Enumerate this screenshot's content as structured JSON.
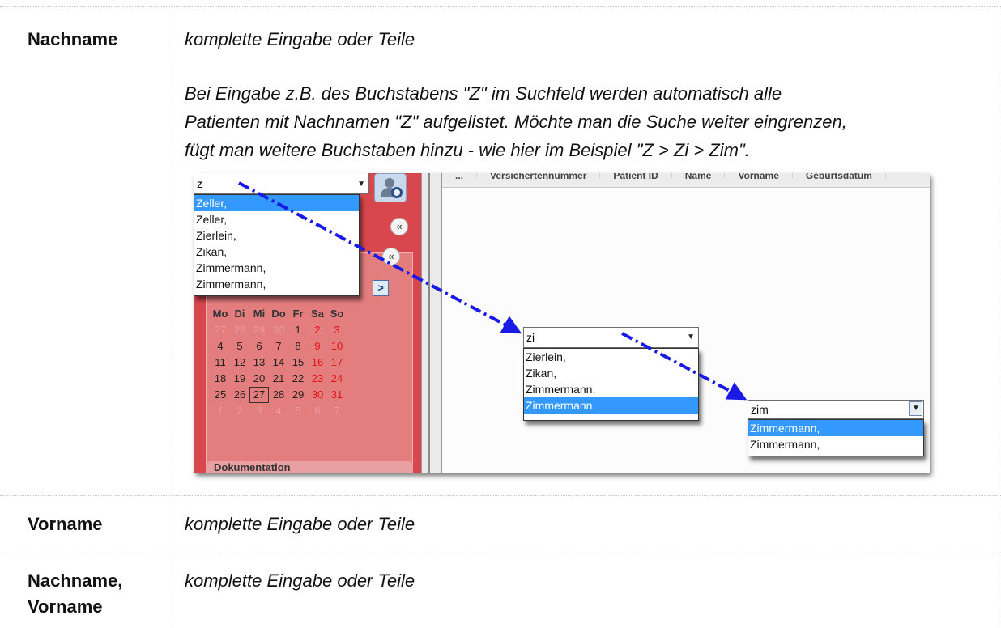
{
  "rows": [
    {
      "label": "Nachname",
      "desc": "komplette Eingabe oder Teile",
      "para_lines": [
        "Bei Eingabe z.B. des Buchstabens \"Z\" im Suchfeld werden automatisch alle",
        "Patienten mit Nachnamen \"Z\" aufgelistet. Möchte man die Suche weiter eingrenzen,",
        "fügt man weitere Buchstaben hinzu - wie hier im Beispiel \"Z > Zi > Zim\"."
      ]
    },
    {
      "label": "Vorname",
      "desc": "komplette Eingabe oder Teile"
    },
    {
      "label_line1": "Nachname,",
      "label_line2": "Vorname",
      "desc": "komplette Eingabe oder Teile"
    }
  ],
  "screenshot": {
    "combo1": {
      "value": "z",
      "items": [
        "Zeller,",
        "Zeller,",
        "Zierlein,",
        "Zikan,",
        "Zimmermann,",
        "Zimmermann,"
      ],
      "selected_index": 0
    },
    "combo2": {
      "value": "zi",
      "items": [
        "Zierlein,",
        "Zikan,",
        "Zimmermann,",
        "Zimmermann,"
      ],
      "selected_index": 3
    },
    "combo3": {
      "value": "zim",
      "items": [
        "Zimmermann,",
        "Zimmermann,"
      ],
      "selected_index": 0
    },
    "calendar": {
      "weekdays": [
        "Mo",
        "Di",
        "Mi",
        "Do",
        "Fr",
        "Sa",
        "So"
      ],
      "weeks": [
        [
          "27",
          "28",
          "29",
          "30",
          "1",
          "2",
          "3"
        ],
        [
          "4",
          "5",
          "6",
          "7",
          "8",
          "9",
          "10"
        ],
        [
          "11",
          "12",
          "13",
          "14",
          "15",
          "16",
          "17"
        ],
        [
          "18",
          "19",
          "20",
          "21",
          "22",
          "23",
          "24"
        ],
        [
          "25",
          "26",
          "27",
          "28",
          "29",
          "30",
          "31"
        ],
        [
          "1",
          "2",
          "3",
          "4",
          "5",
          "6",
          "7"
        ]
      ],
      "today": "27"
    },
    "nav_button": ">",
    "section_label": "Dokumentation",
    "header_columns": [
      "...",
      "Versichertennummer",
      "Patient ID",
      "Name",
      "Vorname",
      "Geburtsdatum"
    ],
    "colors": {
      "selection": "#3399ff",
      "arrow": "#1a1ae6",
      "panel_red": "#d8474d",
      "weekend": "#e21313"
    }
  }
}
